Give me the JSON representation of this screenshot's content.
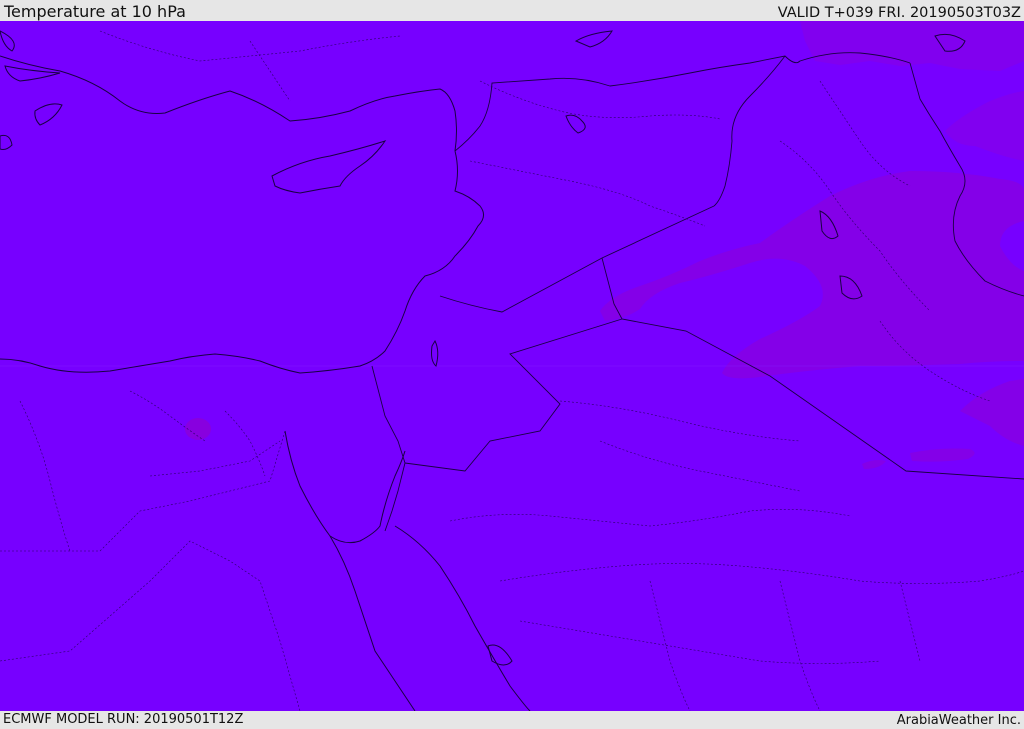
{
  "header": {
    "title": "Temperature at 10 hPa",
    "valid": "VALID T+039 FRI. 20190503T03Z"
  },
  "footer": {
    "model_run": "ECMWF MODEL RUN: 20190501T12Z",
    "credit": "ArabiaWeather Inc."
  },
  "colors": {
    "field_main": "#7700ff",
    "field_warm": "#8a00e4",
    "field_warmer": "#8f00d6",
    "border": "#1a0044",
    "page_bg": "#e6e6e6"
  }
}
